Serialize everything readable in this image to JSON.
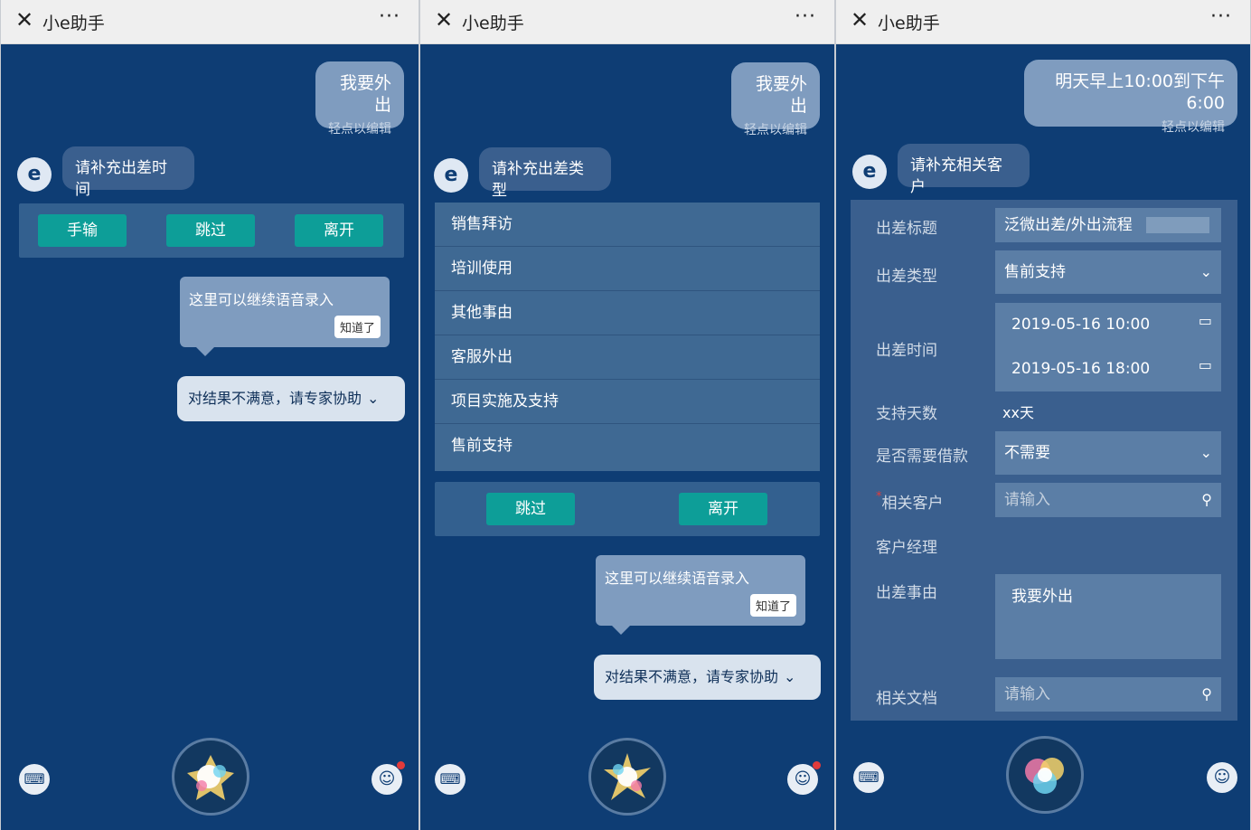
{
  "app_title": "小e助手",
  "panel1": {
    "user_message": "我要外出",
    "edit_hint": "轻点以编辑",
    "bot_message": "请补充出差时间",
    "buttons": [
      "手输",
      "跳过",
      "离开"
    ],
    "tip_text": "这里可以继续语音录入",
    "tip_ok": "知道了",
    "expert_text": "对结果不满意，请专家协助"
  },
  "panel2": {
    "user_message": "我要外出",
    "edit_hint": "轻点以编辑",
    "bot_message": "请补充出差类型",
    "options": [
      "销售拜访",
      "培训使用",
      "其他事由",
      "客服外出",
      "项目实施及支持",
      "售前支持"
    ],
    "buttons": [
      "跳过",
      "离开"
    ],
    "tip_text": "这里可以继续语音录入",
    "tip_ok": "知道了",
    "expert_text": "对结果不满意，请专家协助"
  },
  "panel3": {
    "user_message": "明天早上10:00到下午6:00",
    "edit_hint": "轻点以编辑",
    "bot_message": "请补充相关客户",
    "form": {
      "title_label": "出差标题",
      "title_value": "泛微出差/外出流程",
      "type_label": "出差类型",
      "type_value": "售前支持",
      "time_label": "出差时间",
      "start_time": "2019-05-16 10:00",
      "end_time": "2019-05-16 18:00",
      "days_label": "支持天数",
      "days_value": "xx天",
      "loan_label": "是否需要借款",
      "loan_value": "不需要",
      "customer_label": "相关客户",
      "customer_placeholder": "请输入",
      "manager_label": "客户经理",
      "reason_label": "出差事由",
      "reason_value": "我要外出",
      "doc_label": "相关文档",
      "doc_placeholder": "请输入"
    }
  },
  "colors": {
    "background": "#0e3d74",
    "teal_button": "#0d9e98",
    "user_bubble": "#7f9cbf",
    "notification": "#e23b3b"
  }
}
